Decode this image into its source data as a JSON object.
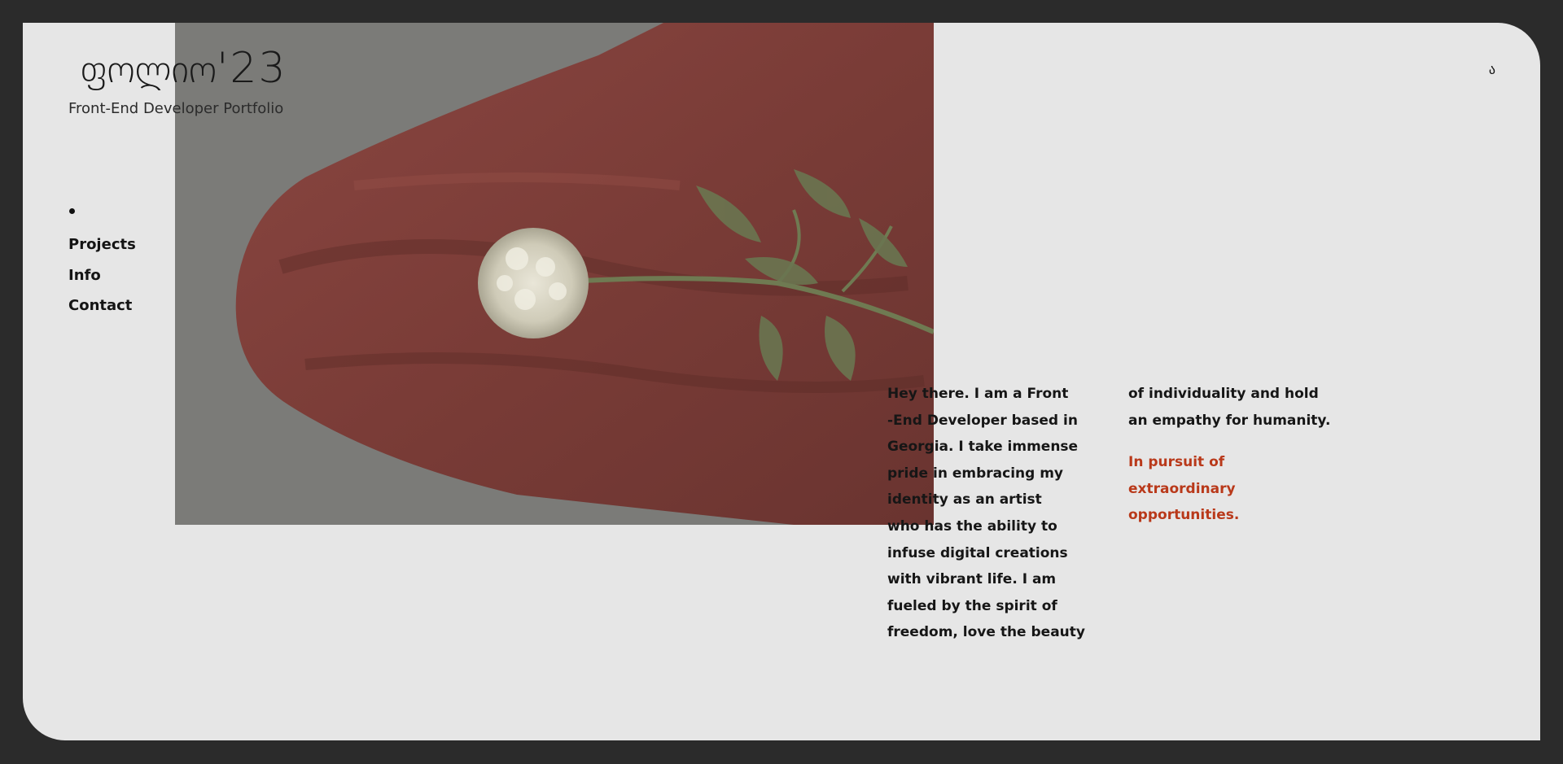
{
  "header": {
    "logo_glyphs": "ფოლიო",
    "logo_year": "'23",
    "subtitle": "Front-End Developer Portfolio",
    "language_toggle": "ა"
  },
  "nav": {
    "items": [
      {
        "label": "Projects"
      },
      {
        "label": "Info"
      },
      {
        "label": "Contact"
      }
    ]
  },
  "intro": {
    "lines_left": [
      "Hey there. I am a Front",
      "-End Developer based in",
      "Georgia. I take immense",
      "pride in embracing my",
      "identity as an artist",
      "who has the ability to",
      "infuse digital creations",
      "with vibrant life. I am",
      "fueled by the spirit of",
      "freedom, love the beauty"
    ],
    "lines_right": [
      "of individuality and hold",
      "an empathy for humanity."
    ],
    "tagline_lines": [
      "In pursuit of",
      "extraordinary",
      "opportunities."
    ]
  },
  "colors": {
    "background_outer": "#2b2b2b",
    "page_background": "#e6e6e6",
    "text": "#161616",
    "accent": "#b9391a",
    "hero_fabric": "#7c3e38"
  },
  "hero": {
    "icon": "flower-on-red-fabric-photo"
  }
}
